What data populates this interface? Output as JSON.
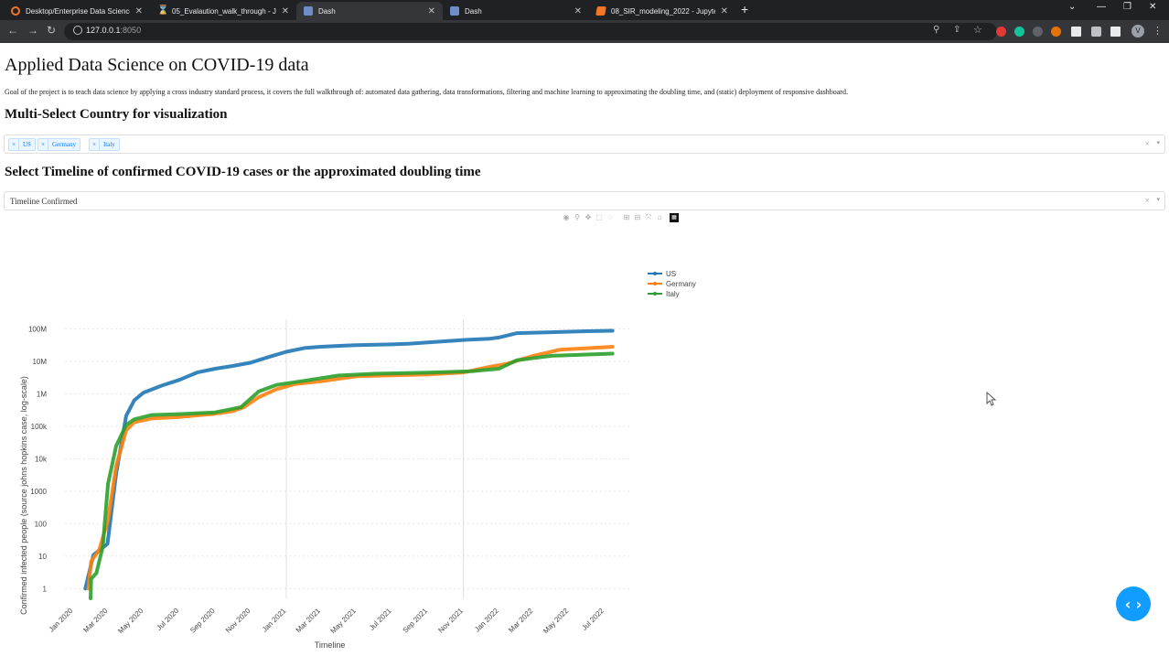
{
  "browser": {
    "tabs": [
      {
        "title": "Desktop/Enterprise Data Science/",
        "icon": "jupyter-circle-icon"
      },
      {
        "title": "05_Evalaution_walk_through - Ju",
        "icon": "hourglass-icon"
      },
      {
        "title": "Dash",
        "icon": "dash-icon"
      },
      {
        "title": "Dash",
        "icon": "dash-icon"
      },
      {
        "title": "08_SIR_modeling_2022 - Jupyter",
        "icon": "notebook-icon"
      }
    ],
    "url_host": "127.0.0.1",
    "url_port": ":8050",
    "profile_initial": "V"
  },
  "page": {
    "title": "Applied Data Science on COVID-19 data",
    "description": "Goal of the project is to teach data science by applying a cross industry standard process, it covers the full walkthrough of: automated data gathering, data transformations, filtering and machine learning to approximating the doubling time, and (static) deployment of responsive dashboard.",
    "country_heading": "Multi-Select Country for visualization",
    "countries": [
      "US",
      "Germany",
      "Italy"
    ],
    "timeline_heading": "Select Timeline of confirmed COVID-19 cases or the approximated doubling time",
    "timeline_value": "Timeline Confirmed",
    "clear_symbol": "×",
    "arrow_symbol": "▾"
  },
  "chart_data": {
    "type": "line",
    "xlabel": "Timeline",
    "ylabel": "Confirmed infected people (source johns hopkins case, log-scale)",
    "yscale": "log",
    "ylim": [
      0.5,
      200000000
    ],
    "x_ticks": [
      "Jan 2020",
      "Mar 2020",
      "May 2020",
      "Jul 2020",
      "Sep 2020",
      "Nov 2020",
      "Jan 2021",
      "Mar 2021",
      "May 2021",
      "Jul 2021",
      "Sep 2021",
      "Nov 2021",
      "Jan 2022",
      "Mar 2022",
      "May 2022",
      "Jul 2022"
    ],
    "y_ticks": [
      "1",
      "10",
      "100",
      "1000",
      "10k",
      "100k",
      "1M",
      "10M",
      "100M"
    ],
    "legend_position": "top-right",
    "series": [
      {
        "name": "US",
        "color": "#1f77b4",
        "points": [
          [
            "2020-01-22",
            1
          ],
          [
            "2020-02-05",
            11
          ],
          [
            "2020-02-29",
            24
          ],
          [
            "2020-03-15",
            3500
          ],
          [
            "2020-04-01",
            210000
          ],
          [
            "2020-04-15",
            640000
          ],
          [
            "2020-05-01",
            1100000
          ],
          [
            "2020-06-01",
            1800000
          ],
          [
            "2020-07-01",
            2700000
          ],
          [
            "2020-08-01",
            4600000
          ],
          [
            "2020-09-01",
            6000000
          ],
          [
            "2020-10-01",
            7300000
          ],
          [
            "2020-11-01",
            9200000
          ],
          [
            "2020-12-01",
            13700000
          ],
          [
            "2021-01-01",
            20000000
          ],
          [
            "2021-02-01",
            26000000
          ],
          [
            "2021-03-01",
            28500000
          ],
          [
            "2021-05-01",
            32000000
          ],
          [
            "2021-07-01",
            33700000
          ],
          [
            "2021-08-01",
            35500000
          ],
          [
            "2021-09-01",
            39000000
          ],
          [
            "2021-11-01",
            46000000
          ],
          [
            "2021-12-15",
            50000000
          ],
          [
            "2022-01-01",
            55000000
          ],
          [
            "2022-02-01",
            75000000
          ],
          [
            "2022-04-01",
            80000000
          ],
          [
            "2022-06-01",
            86000000
          ],
          [
            "2022-07-15",
            89000000
          ]
        ]
      },
      {
        "name": "Germany",
        "color": "#ff7f0e",
        "points": [
          [
            "2020-01-27",
            1
          ],
          [
            "2020-02-01",
            7
          ],
          [
            "2020-02-15",
            16
          ],
          [
            "2020-03-01",
            130
          ],
          [
            "2020-03-15",
            6000
          ],
          [
            "2020-04-01",
            75000
          ],
          [
            "2020-04-15",
            135000
          ],
          [
            "2020-05-15",
            175000
          ],
          [
            "2020-07-01",
            195000
          ],
          [
            "2020-09-01",
            245000
          ],
          [
            "2020-10-01",
            295000
          ],
          [
            "2020-10-20",
            390000
          ],
          [
            "2020-11-15",
            800000
          ],
          [
            "2020-12-15",
            1400000
          ],
          [
            "2021-01-15",
            2000000
          ],
          [
            "2021-03-01",
            2450000
          ],
          [
            "2021-05-01",
            3500000
          ],
          [
            "2021-07-01",
            3750000
          ],
          [
            "2021-09-01",
            4000000
          ],
          [
            "2021-11-01",
            4600000
          ],
          [
            "2021-12-15",
            6800000
          ],
          [
            "2022-01-15",
            8500000
          ],
          [
            "2022-03-01",
            15000000
          ],
          [
            "2022-04-15",
            23000000
          ],
          [
            "2022-07-15",
            28500000
          ]
        ]
      },
      {
        "name": "Italy",
        "color": "#2ca02c",
        "points": [
          [
            "2020-01-31",
            0.5
          ],
          [
            "2020-02-01",
            2
          ],
          [
            "2020-02-10",
            3
          ],
          [
            "2020-02-21",
            20
          ],
          [
            "2020-03-01",
            1700
          ],
          [
            "2020-03-15",
            25000
          ],
          [
            "2020-04-01",
            110000
          ],
          [
            "2020-04-15",
            165000
          ],
          [
            "2020-05-15",
            225000
          ],
          [
            "2020-07-01",
            240000
          ],
          [
            "2020-09-01",
            270000
          ],
          [
            "2020-10-15",
            390000
          ],
          [
            "2020-11-15",
            1200000
          ],
          [
            "2020-12-15",
            1900000
          ],
          [
            "2021-02-01",
            2550000
          ],
          [
            "2021-04-01",
            3700000
          ],
          [
            "2021-06-01",
            4200000
          ],
          [
            "2021-09-01",
            4550000
          ],
          [
            "2021-11-15",
            5000000
          ],
          [
            "2022-01-01",
            6000000
          ],
          [
            "2022-02-01",
            11000000
          ],
          [
            "2022-04-01",
            15000000
          ],
          [
            "2022-07-15",
            17500000
          ]
        ]
      }
    ]
  }
}
